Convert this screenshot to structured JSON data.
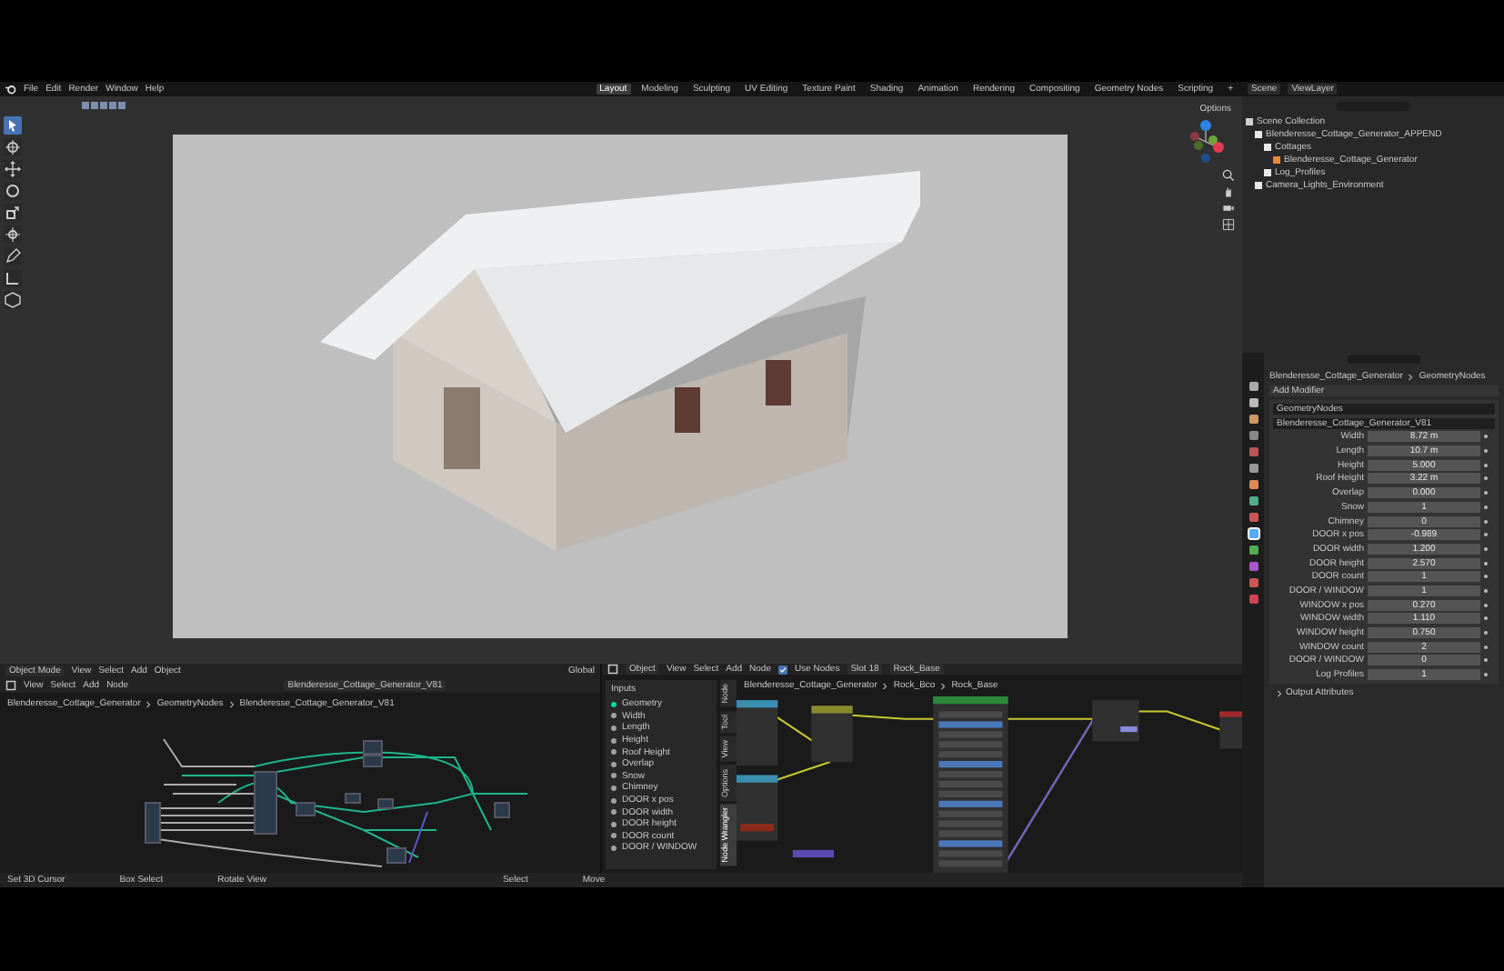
{
  "menu": [
    "File",
    "Edit",
    "Render",
    "Window",
    "Help"
  ],
  "workspaces": [
    {
      "label": "Layout",
      "selected": true
    },
    {
      "label": "Modeling",
      "selected": false
    },
    {
      "label": "Sculpting",
      "selected": false
    },
    {
      "label": "UV Editing",
      "selected": false
    },
    {
      "label": "Texture Paint",
      "selected": false
    },
    {
      "label": "Shading",
      "selected": false
    },
    {
      "label": "Animation",
      "selected": false
    },
    {
      "label": "Rendering",
      "selected": false
    },
    {
      "label": "Compositing",
      "selected": false
    },
    {
      "label": "Geometry Nodes",
      "selected": false
    },
    {
      "label": "Scripting",
      "selected": false
    },
    {
      "label": "+",
      "selected": false
    }
  ],
  "viewport": {
    "options": "Options"
  },
  "outliner": {
    "scene": "Scene",
    "view_layer": "ViewLayer",
    "items": [
      {
        "label": "Scene Collection",
        "kind": "scene",
        "children": [
          {
            "label": "Blenderesse_Cottage_Generator_APPEND",
            "kind": "collection",
            "children": [
              {
                "label": "Cottages",
                "kind": "collection",
                "children": [
                  {
                    "label": "Blenderesse_Cottage_Generator",
                    "kind": "object"
                  }
                ]
              },
              {
                "label": "Log_Profiles",
                "kind": "collection"
              }
            ]
          },
          {
            "label": "Camera_Lights_Environment",
            "kind": "collection"
          }
        ]
      }
    ]
  },
  "properties": {
    "breadcrumb": [
      "Blenderesse_Cottage_Generator",
      "GeometryNodes"
    ],
    "add_modifier": "Add Modifier",
    "modifier_name": "GeometryNodes",
    "node_group": "Blenderesse_Cottage_Generator_V81",
    "params": [
      {
        "label": "Width",
        "value": "8.72 m"
      },
      {
        "label": "Length",
        "value": "10.7 m"
      },
      {
        "label": "Height",
        "value": "5.000"
      },
      {
        "label": "Roof Height",
        "value": "3.22 m"
      },
      {
        "label": "Overlap",
        "value": "0.000"
      },
      {
        "label": "Snow",
        "value": "1"
      },
      {
        "label": "Chimney",
        "value": "0"
      },
      {
        "label": "DOOR x pos",
        "value": "-0.989"
      },
      {
        "label": "DOOR width",
        "value": "1.200"
      },
      {
        "label": "DOOR height",
        "value": "2.570"
      },
      {
        "label": "DOOR count",
        "value": "1"
      },
      {
        "label": "DOOR / WINDOW",
        "value": "1"
      },
      {
        "label": "WINDOW x pos",
        "value": "0.270"
      },
      {
        "label": "WINDOW width",
        "value": "1.110"
      },
      {
        "label": "WINDOW height",
        "value": "0.750"
      },
      {
        "label": "WINDOW count",
        "value": "2"
      },
      {
        "label": "DOOR / WINDOW",
        "value": "0"
      },
      {
        "label": "Log Profiles",
        "value": "1"
      }
    ],
    "output_attributes": "Output Attributes"
  },
  "node_editor_left": {
    "mode": "Object Mode",
    "top_menu": [
      "View",
      "Select",
      "Add",
      "Object"
    ],
    "orientation": "Global",
    "menu": [
      "View",
      "Select",
      "Add",
      "Node"
    ],
    "node_group": "Blenderesse_Cottage_Generator_V81",
    "breadcrumb": [
      "Blenderesse_Cottage_Generator",
      "GeometryNodes",
      "Blenderesse_Cottage_Generator_V81"
    ]
  },
  "node_editor_right": {
    "mode": "Object",
    "menu": [
      "View",
      "Select",
      "Add",
      "Node"
    ],
    "use_nodes": {
      "label": "Use Nodes",
      "checked": true
    },
    "slot": "Slot 18",
    "material": "Rock_Base",
    "breadcrumb": [
      "Blenderesse_Cottage_Generator",
      "Rock_Bco",
      "Rock_Base"
    ],
    "sidebar_tabs": [
      {
        "label": "Node",
        "selected": false
      },
      {
        "label": "Tool",
        "selected": false
      },
      {
        "label": "View",
        "selected": false
      },
      {
        "label": "Options",
        "selected": false
      },
      {
        "label": "Node Wrangler",
        "selected": true
      }
    ],
    "inputs_panel": {
      "title": "Inputs",
      "items": [
        {
          "label": "Geometry",
          "color": "#00d6a3"
        },
        {
          "label": "Width",
          "color": "#a1a1a1"
        },
        {
          "label": "Length",
          "color": "#a1a1a1"
        },
        {
          "label": "Height",
          "color": "#a1a1a1"
        },
        {
          "label": "Roof Height",
          "color": "#a1a1a1"
        },
        {
          "label": "Overlap",
          "color": "#a1a1a1"
        },
        {
          "label": "Snow",
          "color": "#a1a1a1"
        },
        {
          "label": "Chimney",
          "color": "#a1a1a1"
        },
        {
          "label": "DOOR x pos",
          "color": "#a1a1a1"
        },
        {
          "label": "DOOR width",
          "color": "#a1a1a1"
        },
        {
          "label": "DOOR height",
          "color": "#a1a1a1"
        },
        {
          "label": "DOOR count",
          "color": "#a1a1a1"
        },
        {
          "label": "DOOR / WINDOW",
          "color": "#a1a1a1"
        }
      ]
    }
  },
  "status_bar": [
    "Set 3D Cursor",
    "Box Select",
    "Rotate View",
    "Select",
    "Move"
  ]
}
